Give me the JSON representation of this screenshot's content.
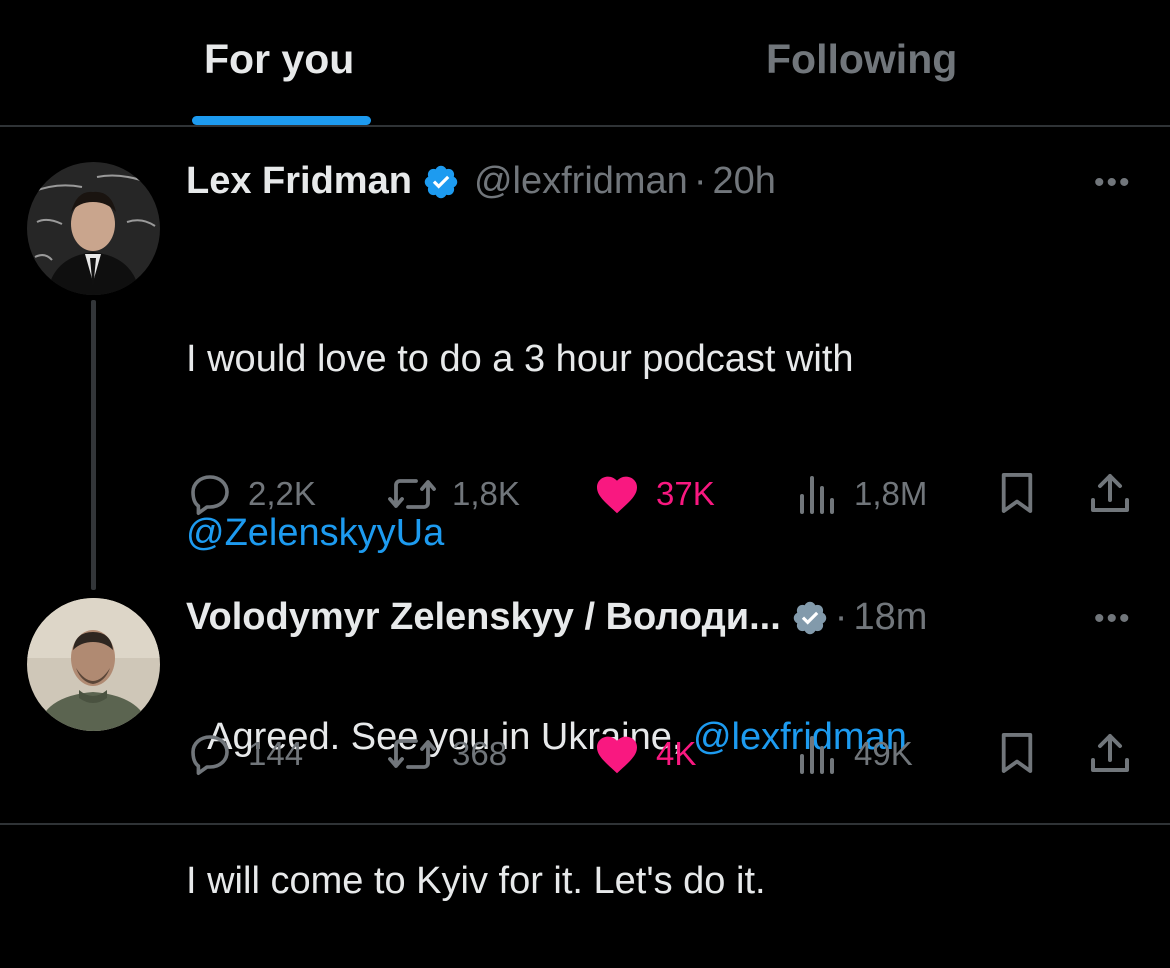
{
  "tabs": [
    {
      "label": "For you",
      "active": true
    },
    {
      "label": "Following",
      "active": false
    }
  ],
  "tweets": [
    {
      "name": "Lex Fridman",
      "handle": "@lexfridman",
      "separator": "·",
      "time": "20h",
      "text_line1": "I would love to do a 3 hour podcast with",
      "mention1": "@ZelenskyyUa",
      "text_line2": "I will come to Kyiv for it. Let's do it.",
      "replies": "2,2K",
      "retweets": "1,8K",
      "likes": "37K",
      "views": "1,8M",
      "more": "•••"
    },
    {
      "name": "Volodymyr Zelenskyy / Володи...",
      "separator": "·",
      "time": "18m",
      "text_prefix": "Agreed. See you in Ukraine, ",
      "mention1": "@lexfridman",
      "replies": "144",
      "retweets": "368",
      "likes": "4K",
      "views": "49K",
      "more": "•••"
    }
  ],
  "colors": {
    "background": "#000000",
    "text": "#e7e9ea",
    "muted": "#71767b",
    "accent": "#1d9bf0",
    "like": "#f91880"
  },
  "icons": [
    "reply-icon",
    "retweet-icon",
    "like-icon",
    "views-icon",
    "bookmark-icon",
    "share-icon",
    "verified-badge-icon",
    "more-icon"
  ]
}
